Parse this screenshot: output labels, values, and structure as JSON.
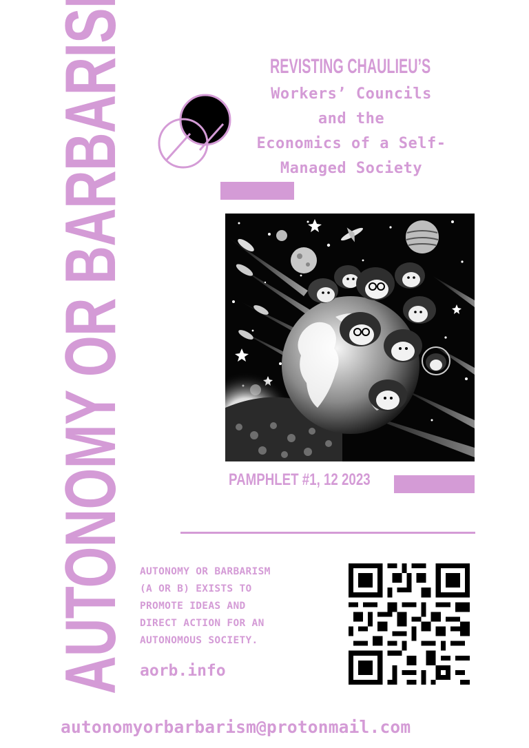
{
  "side_title": "AUTONOMY OR BARBARISM",
  "heading": "REVISTING CHAULIEU’S",
  "subtitle_lines": [
    "Workers’ Councils",
    "and the",
    "Economics of a Self-",
    "Managed Society"
  ],
  "pamphlet_label": "PAMPHLET #1, 12 2023",
  "description_lines": [
    "AUTONOMY OR BARBARISM",
    "(A OR B) EXISTS TO",
    "PROMOTE IDEAS AND",
    "DIRECT ACTION FOR AN",
    "AUTONOMOUS SOCIETY."
  ],
  "website": "aorb.info",
  "email": "autonomyorbarbarism@protonmail.com",
  "colors": {
    "accent": "#d49bd6",
    "background": "#ffffff",
    "ink": "#000000"
  },
  "icons": {
    "logo": "overlapping-circles-logo",
    "qr": "qr-code"
  }
}
